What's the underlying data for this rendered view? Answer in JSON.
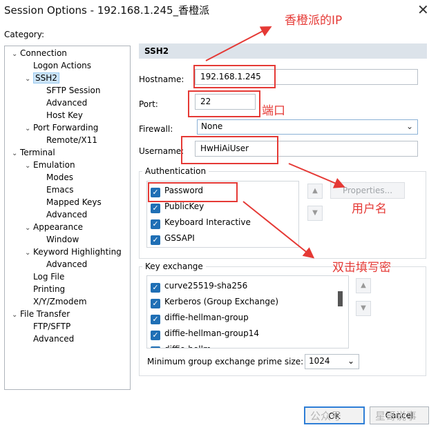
{
  "window": {
    "title": "Session Options - 192.168.1.245_香橙派",
    "close_glyph": "✕"
  },
  "category_label": "Category:",
  "tree": [
    {
      "label": "Connection",
      "chev": "⌄",
      "name": "tree-connection"
    },
    {
      "label": "Logon Actions",
      "chev": "",
      "name": "tree-logon-actions"
    },
    {
      "label": "SSH2",
      "chev": "⌄",
      "name": "tree-ssh2"
    },
    {
      "label": "SFTP Session",
      "chev": "",
      "name": "tree-sftp-session"
    },
    {
      "label": "Advanced",
      "chev": "",
      "name": "tree-ssh2-advanced"
    },
    {
      "label": "Host Key",
      "chev": "",
      "name": "tree-host-key"
    },
    {
      "label": "Port Forwarding",
      "chev": "⌄",
      "name": "tree-port-forwarding"
    },
    {
      "label": "Remote/X11",
      "chev": "",
      "name": "tree-remote-x11"
    },
    {
      "label": "Terminal",
      "chev": "⌄",
      "name": "tree-terminal"
    },
    {
      "label": "Emulation",
      "chev": "⌄",
      "name": "tree-emulation"
    },
    {
      "label": "Modes",
      "chev": "",
      "name": "tree-modes"
    },
    {
      "label": "Emacs",
      "chev": "",
      "name": "tree-emacs"
    },
    {
      "label": "Mapped Keys",
      "chev": "",
      "name": "tree-mapped-keys"
    },
    {
      "label": "Advanced",
      "chev": "",
      "name": "tree-emulation-advanced"
    },
    {
      "label": "Appearance",
      "chev": "⌄",
      "name": "tree-appearance"
    },
    {
      "label": "Window",
      "chev": "",
      "name": "tree-window"
    },
    {
      "label": "Keyword Highlighting",
      "chev": "⌄",
      "name": "tree-keyword-highlighting"
    },
    {
      "label": "Advanced",
      "chev": "",
      "name": "tree-keyword-advanced"
    },
    {
      "label": "Log File",
      "chev": "",
      "name": "tree-log-file"
    },
    {
      "label": "Printing",
      "chev": "",
      "name": "tree-printing"
    },
    {
      "label": "X/Y/Zmodem",
      "chev": "",
      "name": "tree-xyzmodem"
    },
    {
      "label": "File Transfer",
      "chev": "⌄",
      "name": "tree-file-transfer"
    },
    {
      "label": "FTP/SFTP",
      "chev": "",
      "name": "tree-ftp-sftp"
    },
    {
      "label": "Advanced",
      "chev": "",
      "name": "tree-file-transfer-advanced"
    }
  ],
  "section_title": "SSH2",
  "form": {
    "hostname_label": "Hostname:",
    "hostname_value": "192.168.1.245",
    "port_label": "Port:",
    "port_value": "22",
    "firewall_label": "Firewall:",
    "firewall_value": "None",
    "username_label": "Username:",
    "username_value": "HwHiAiUser"
  },
  "authentication": {
    "title": "Authentication",
    "methods": [
      "Password",
      "PublicKey",
      "Keyboard Interactive",
      "GSSAPI"
    ],
    "properties_label": "Properties...",
    "up_glyph": "▲",
    "down_glyph": "▼"
  },
  "key_exchange": {
    "title": "Key exchange",
    "items": [
      "curve25519-sha256",
      "Kerberos (Group Exchange)",
      "diffie-hellman-group",
      "diffie-hellman-group14",
      "diffie-hellm..."
    ],
    "min_group_label": "Minimum group exchange prime size:",
    "min_group_value": "1024"
  },
  "buttons": {
    "ok": "OK",
    "cancel": "Cancel"
  },
  "checkmark": "✓",
  "chevron_down": "⌄",
  "annotations": {
    "ip_note": "香橙派的IP",
    "port_note": "端口",
    "user_note": "用户名",
    "password_note": "双击填写密"
  },
  "watermark": {
    "left": "公众号",
    "right": "星哥说事"
  },
  "colors": {
    "annotation": "#e53935",
    "accent": "#1f6fb5",
    "section_bg": "#dce3ea"
  }
}
